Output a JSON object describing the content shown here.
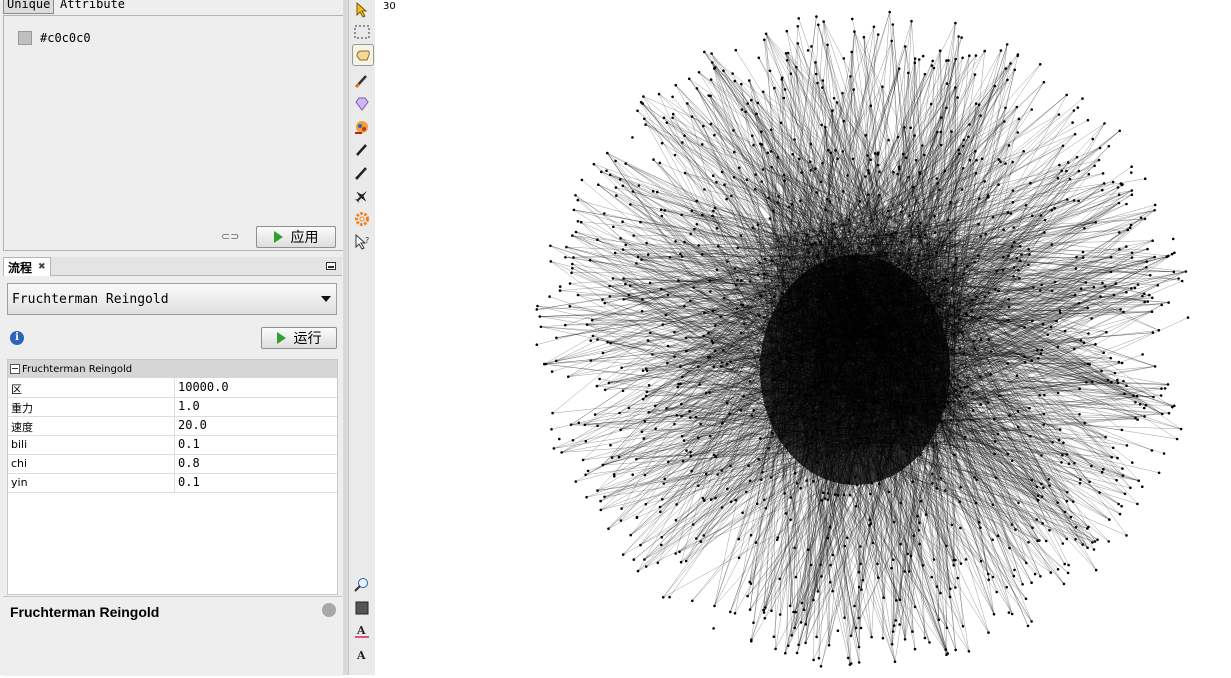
{
  "partition": {
    "tab_unique": "Unique",
    "tab_attribute": "Attribute",
    "items": [
      {
        "label": "#c0c0c0",
        "color": "#c0c0c0"
      }
    ],
    "apply_label": "应用"
  },
  "layout": {
    "tab_label": "流程",
    "algorithm": "Fruchterman Reingold",
    "run_label": "运行",
    "section_title": "Fruchterman Reingold",
    "properties": [
      {
        "name": "区",
        "value": "10000.0"
      },
      {
        "name": "重力",
        "value": "1.0"
      },
      {
        "name": "速度",
        "value": "20.0"
      },
      {
        "name": "bili",
        "value": "0.1"
      },
      {
        "name": "chi",
        "value": "0.8"
      },
      {
        "name": "yin",
        "value": "0.1"
      }
    ],
    "description_title": "Fruchterman Reingold"
  },
  "toolbar": {
    "tools": [
      "pointer-icon",
      "rectangle-select-icon",
      "drag-hand-icon",
      "brush-icon",
      "diamond-icon",
      "color-wheel-icon",
      "pencil-icon",
      "edge-pencil-icon",
      "airplane-icon",
      "settings-gear-icon",
      "help-cursor-icon"
    ],
    "bottom_tools": [
      "zoom-icon",
      "node-square-icon",
      "text-color-icon",
      "text-size-icon"
    ]
  },
  "graph": {
    "corner_label": "30",
    "node_color": "#000000",
    "edge_color": "#000000"
  }
}
